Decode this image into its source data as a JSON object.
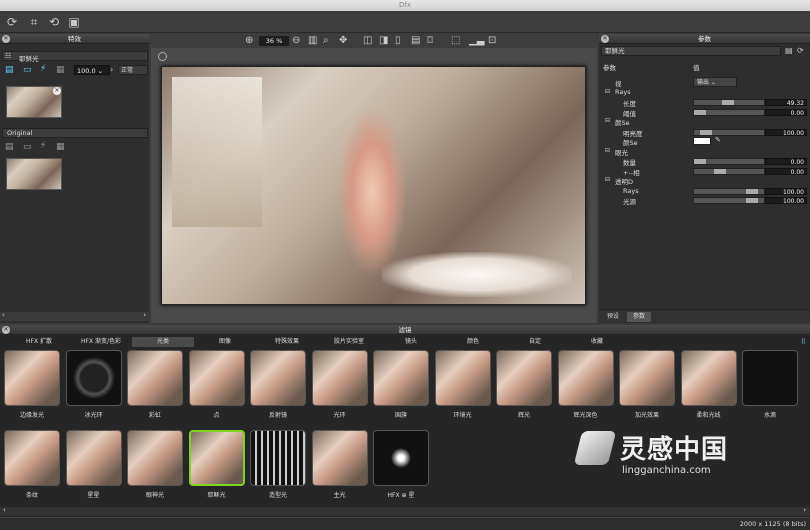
{
  "window_title": "Dfx",
  "left_panel": {
    "title": "特效",
    "effect_name": "耶稣光",
    "zoom_value": "100.0",
    "blend_mode": "正常",
    "original_label": "Original"
  },
  "toolbar": {
    "zoom_percent": "36 %"
  },
  "right_panel": {
    "title": "参数",
    "effect_name": "耶稣光",
    "col_param": "参数",
    "col_value": "值",
    "rows": [
      {
        "label": "视",
        "indent": 1,
        "type": "select",
        "value": "输出"
      },
      {
        "label": "Rays",
        "indent": 1,
        "type": "group"
      },
      {
        "label": "长度",
        "indent": 2,
        "type": "slider",
        "value": "49.32",
        "level": 0.49
      },
      {
        "label": "阈值",
        "indent": 2,
        "type": "slider",
        "value": "0.00",
        "level": 0.0
      },
      {
        "label": "颜Se",
        "indent": 1,
        "type": "group"
      },
      {
        "label": "明亮度",
        "indent": 2,
        "type": "slider",
        "value": "100.00",
        "level": 0.1
      },
      {
        "label": "颜Se",
        "indent": 2,
        "type": "color",
        "value": "#ffffff"
      },
      {
        "label": "眼光",
        "indent": 1,
        "type": "group"
      },
      {
        "label": "数量",
        "indent": 2,
        "type": "slider",
        "value": "0.00",
        "level": 0.0
      },
      {
        "label": "+--相",
        "indent": 2,
        "type": "slider",
        "value": "0.00",
        "level": 0.35
      },
      {
        "label": "透明D",
        "indent": 1,
        "type": "group"
      },
      {
        "label": "Rays",
        "indent": 2,
        "type": "slider",
        "value": "100.00",
        "level": 0.9
      },
      {
        "label": "光源",
        "indent": 2,
        "type": "slider",
        "value": "100.00",
        "level": 0.9
      }
    ],
    "tab_presets": "预设",
    "tab_params": "参数"
  },
  "filters": {
    "title": "滤镜",
    "tabs": [
      "HFX 扩散",
      "HFX 渐变/色彩",
      "光类",
      "图像",
      "特殊效果",
      "胶片实验室",
      "镜头",
      "颜色",
      "自定",
      "收藏"
    ],
    "active_tab": 2,
    "row1": [
      "边缘发光",
      "冰光环",
      "彩虹",
      "点",
      "反射镜",
      "光环",
      "国旗",
      "环境光",
      "辉光",
      "辉光深色",
      "加光效果",
      "柔和光线",
      "水滴"
    ],
    "row2": [
      "条纹",
      "星星",
      "眼神光",
      "耶稣光",
      "造型光",
      "主光",
      "HFX ⊕ 星"
    ],
    "selected_row2": 3
  },
  "status": {
    "dims": "2000 x 1125 (8 bits)"
  },
  "watermark": {
    "brand_cn": "灵感中国",
    "brand_url": "lingganchina.com"
  }
}
